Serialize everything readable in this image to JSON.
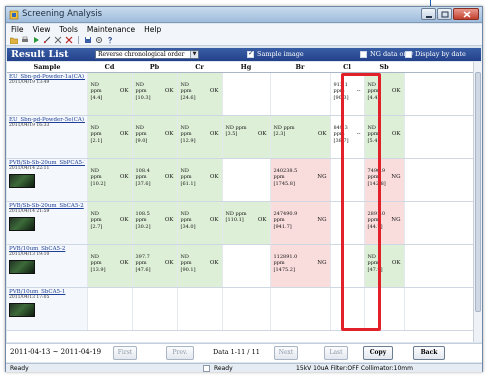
{
  "window": {
    "title": "Screening Analysis"
  },
  "menu": [
    "File",
    "View",
    "Tools",
    "Maintenance",
    "Help"
  ],
  "toolbar_icons": [
    "folder-open-icon",
    "print-icon",
    "play-icon",
    "measure-icon",
    "tools-icon",
    "cross-icon",
    "save-icon",
    "settings-icon",
    "help-icon"
  ],
  "result_bar": {
    "title": "Result List",
    "sort_value": "Reverse chronological order",
    "sample_image_label": "Sample image",
    "sample_image_checked": true,
    "ng_only_label": "NG data only",
    "ng_only_checked": false,
    "display_by_date_label": "Display by date",
    "display_by_date_checked": false
  },
  "columns": [
    "Sample",
    "Cd",
    "Pb",
    "Cr",
    "Hg",
    "Br",
    "Cl",
    "Sb"
  ],
  "rows": [
    {
      "name": "EU_Sbn-pd-Powder-1a(CA) 1",
      "date": "2011/04/19 13:49",
      "thumb": false,
      "cells": [
        {
          "c": "green",
          "v": "ND\nppm\n[4.4]",
          "s": "OK"
        },
        {
          "c": "green",
          "v": "ND\nppm\n[10.3]",
          "s": "OK"
        },
        {
          "c": "green",
          "v": "ND\nppm\n[24.6]",
          "s": "OK"
        },
        {
          "c": "white",
          "v": "",
          "s": ""
        },
        {
          "c": "white",
          "v": "",
          "s": ""
        },
        {
          "c": "white",
          "v": "913.1\nppm\n[90.3]",
          "s": "--"
        },
        {
          "c": "green",
          "v": "ND\nppm\n[4.4]",
          "s": "OK"
        }
      ]
    },
    {
      "name": "EU_Sbn-pd-Powder-5e(CA) 1",
      "date": "2011/04/19 16:33",
      "thumb": false,
      "cells": [
        {
          "c": "green",
          "v": "ND\nppm\n[2.1]",
          "s": "OK"
        },
        {
          "c": "green",
          "v": "ND\nppm\n[9.0]",
          "s": "OK"
        },
        {
          "c": "green",
          "v": "ND\nppm\n[12.9]",
          "s": "OK"
        },
        {
          "c": "green",
          "v": "ND ppm\n[3.5]",
          "s": "OK"
        },
        {
          "c": "green",
          "v": "ND ppm\n[2.3]",
          "s": "OK"
        },
        {
          "c": "white",
          "v": "849.3\nppm\n[38.7]",
          "s": "--"
        },
        {
          "c": "green",
          "v": "ND\nppm\n[5.4]",
          "s": "OK"
        }
      ]
    },
    {
      "name": "PVB/Sb-Sb-20um_SbPCA5-1",
      "date": "2011/04/14 22:11",
      "thumb": true,
      "cells": [
        {
          "c": "green",
          "v": "ND\nppm\n[10.2]",
          "s": "OK"
        },
        {
          "c": "green",
          "v": "108.4\nppm\n[37.6]",
          "s": "OK"
        },
        {
          "c": "green",
          "v": "ND\nppm\n[61.1]",
          "s": "OK"
        },
        {
          "c": "white",
          "v": "",
          "s": ""
        },
        {
          "c": "pink",
          "v": "240238.5\nppm\n[1745.8]",
          "s": "NG"
        },
        {
          "c": "white",
          "v": "",
          "s": ""
        },
        {
          "c": "pink",
          "v": "7490.9\nppm\n[142.8]",
          "s": "NG"
        }
      ]
    },
    {
      "name": "PVB/Sb-Sb-20um_SbCA5-2",
      "date": "2011/04/14 21:59",
      "thumb": true,
      "cells": [
        {
          "c": "green",
          "v": "ND\nppm\n[2.7]",
          "s": "OK"
        },
        {
          "c": "green",
          "v": "108.5\nppm\n[30.2]",
          "s": "OK"
        },
        {
          "c": "green",
          "v": "ND\nppm\n[34.0]",
          "s": "OK"
        },
        {
          "c": "green",
          "v": "ND ppm\n[110.1]",
          "s": "OK"
        },
        {
          "c": "pink",
          "v": "247490.9\nppm\n[941.7]",
          "s": "NG"
        },
        {
          "c": "white",
          "v": "",
          "s": ""
        },
        {
          "c": "pink",
          "v": "2891.0\nppm\n[44.7]",
          "s": "NG"
        }
      ]
    },
    {
      "name": "PVB/10um_SbCA5-2",
      "date": "2011/04/13 19:10",
      "thumb": true,
      "cells": [
        {
          "c": "green",
          "v": "ND\nppm\n[13.9]",
          "s": "OK"
        },
        {
          "c": "green",
          "v": "397.7\nppm\n[47.6]",
          "s": "OK"
        },
        {
          "c": "green",
          "v": "ND\nppm\n[90.1]",
          "s": "OK"
        },
        {
          "c": "white",
          "v": "",
          "s": ""
        },
        {
          "c": "pink",
          "v": "112891.0\nppm\n[1475.2]",
          "s": "NG"
        },
        {
          "c": "white",
          "v": "",
          "s": ""
        },
        {
          "c": "green",
          "v": "ND\nppm\n[47.9]",
          "s": "OK"
        }
      ]
    },
    {
      "name": "PVB/10um_SbCA5-1",
      "date": "2011/04/13 17:05",
      "thumb": true,
      "cells": [
        {
          "c": "white",
          "v": "",
          "s": ""
        },
        {
          "c": "white",
          "v": "",
          "s": ""
        },
        {
          "c": "white",
          "v": "",
          "s": ""
        },
        {
          "c": "white",
          "v": "",
          "s": ""
        },
        {
          "c": "white",
          "v": "",
          "s": ""
        },
        {
          "c": "white",
          "v": "",
          "s": ""
        },
        {
          "c": "white",
          "v": "",
          "s": ""
        }
      ]
    }
  ],
  "nav": {
    "date_range": "2011-04-13 ~ 2011-04-19",
    "first": "First",
    "prev": "Prev.",
    "data_count": "Data 1-11 / 11",
    "next": "Next",
    "last": "Last",
    "copy": "Copy",
    "back": "Back"
  },
  "status": {
    "ready1": "Ready",
    "ready2": "Ready",
    "params": "15kV  10uA  Filter:OFF  Collimator:10mm"
  }
}
